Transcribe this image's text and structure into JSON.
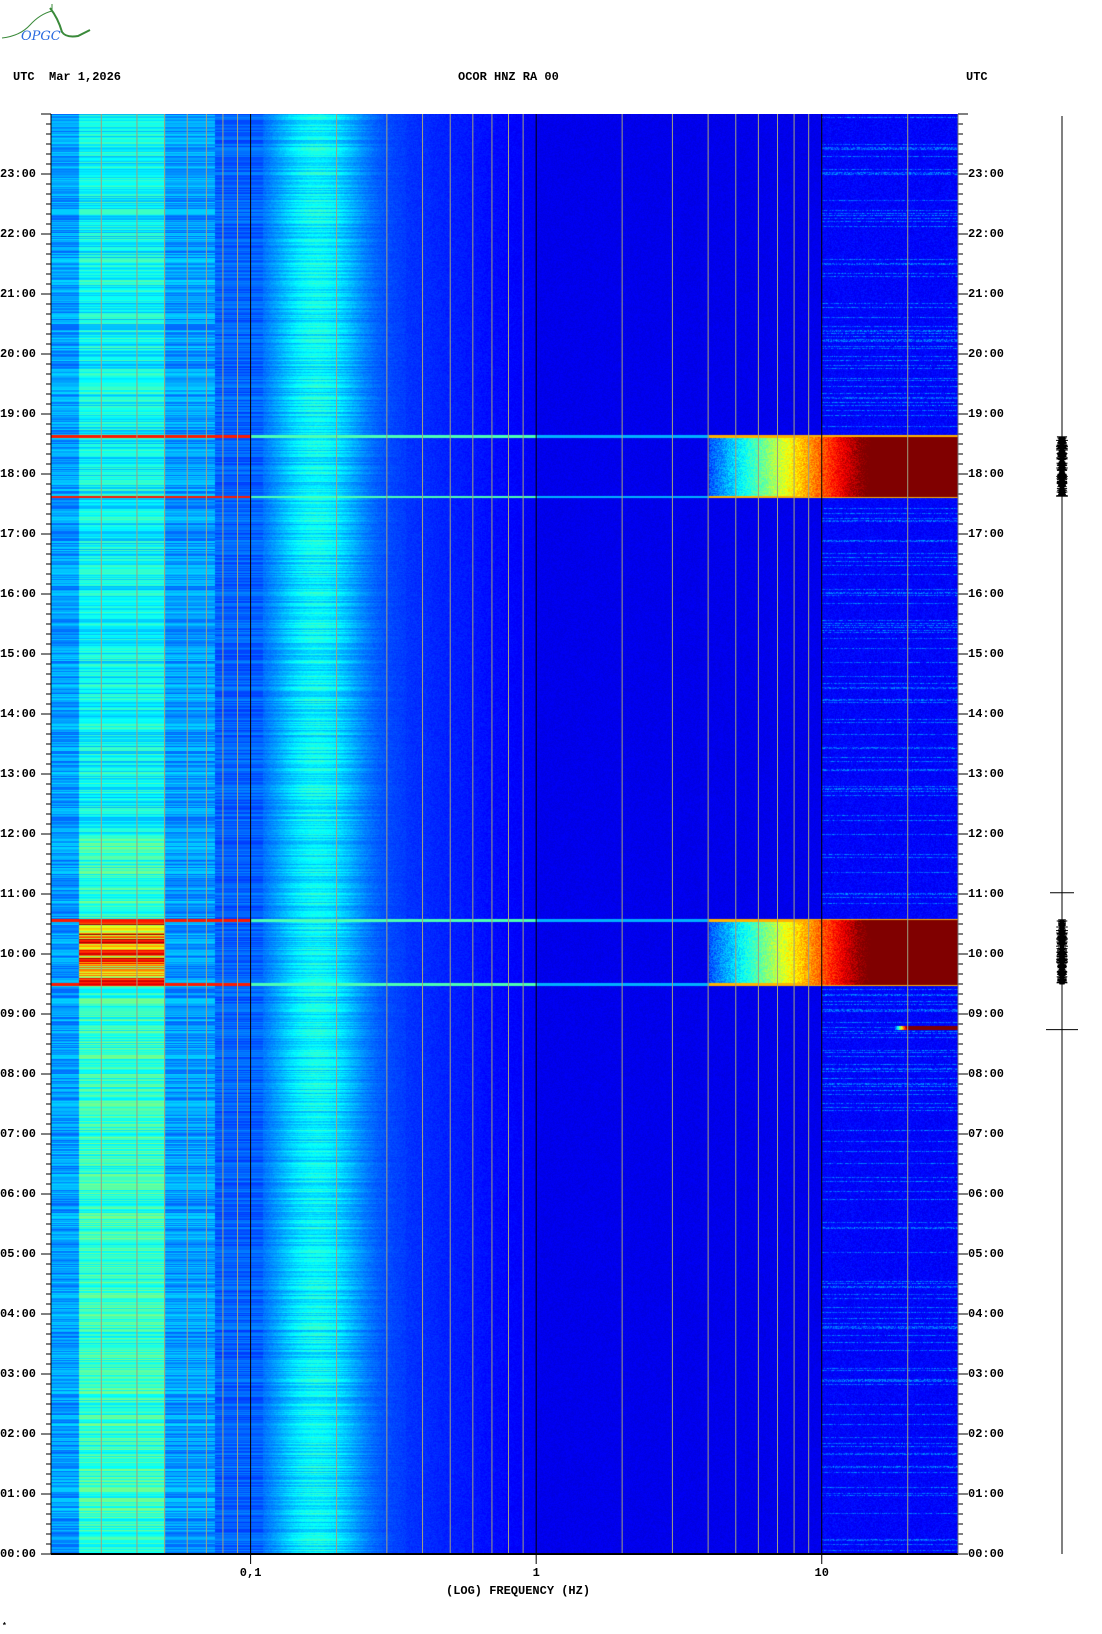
{
  "header": {
    "left_label": "UTC",
    "date": "Mar 1,2026",
    "station": "OCOR HNZ RA 00",
    "right_label": "UTC"
  },
  "logo": {
    "text": "OPGC"
  },
  "footer_mark": "*",
  "chart_data": {
    "type": "heatmap",
    "title": "OCOR HNZ RA 00",
    "xlabel": "(LOG) FREQUENCY (HZ)",
    "ylabel": "UTC",
    "x_scale": "log",
    "xlim": [
      0.02,
      30
    ],
    "ylim_hours": [
      0,
      24
    ],
    "x_ticks": [
      {
        "value": 0.1,
        "label": "0,1"
      },
      {
        "value": 1,
        "label": "1"
      },
      {
        "value": 10,
        "label": "10"
      }
    ],
    "y_ticks": [
      "00:00",
      "01:00",
      "02:00",
      "03:00",
      "04:00",
      "05:00",
      "06:00",
      "07:00",
      "08:00",
      "09:00",
      "10:00",
      "11:00",
      "12:00",
      "13:00",
      "14:00",
      "15:00",
      "16:00",
      "17:00",
      "18:00",
      "19:00",
      "20:00",
      "21:00",
      "22:00",
      "23:00"
    ],
    "colormap": "jet",
    "events": [
      {
        "start_hour": 17.63,
        "end_hour": 18.63,
        "fmin_hz": 4,
        "saturated_above_hz": 15
      },
      {
        "start_hour": 9.5,
        "end_hour": 10.57,
        "fmin_hz": 4,
        "saturated_above_hz": 15
      },
      {
        "start_hour": 8.74,
        "end_hour": 8.8,
        "fmin_hz": 18,
        "saturated_above_hz": 20
      }
    ],
    "colors": {
      "low": "#00007f",
      "high": "#7f0000",
      "grid_minor": "#a0a080",
      "grid_decade": "#000000"
    }
  }
}
